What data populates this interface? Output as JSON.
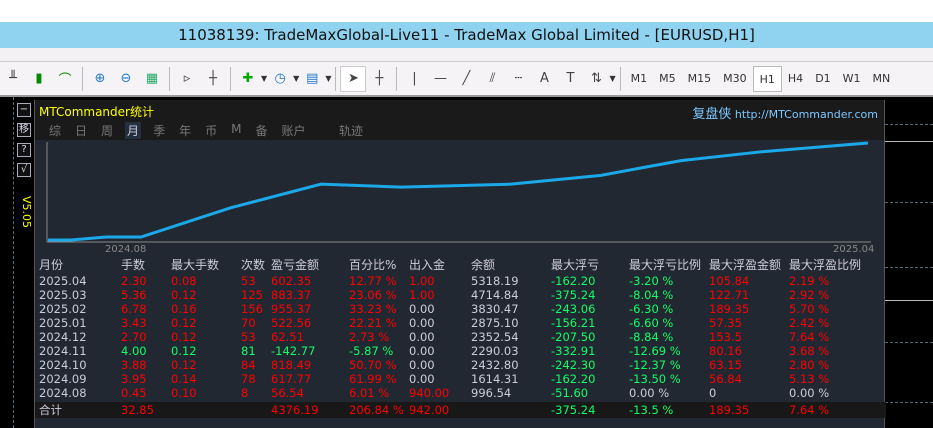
{
  "window": {
    "title": "11038139: TradeMaxGlobal-Live11 - TradeMax Global Limited - [EURUSD,H1]"
  },
  "toolbar": {
    "timeframes": [
      "M1",
      "M5",
      "M15",
      "M30",
      "H1",
      "H4",
      "D1",
      "W1",
      "MN"
    ],
    "active_timeframe": "H1"
  },
  "side": {
    "buttons": [
      "−",
      "移",
      "?",
      "√"
    ],
    "version": "V5.05"
  },
  "panel": {
    "title": "MTCommander统计",
    "brand": "复盘侠",
    "url": "http://MTCommander.com",
    "tabs": [
      "综",
      "日",
      "周",
      "月",
      "季",
      "年",
      "币",
      "M",
      "备",
      "账户"
    ],
    "active_tab": "月",
    "trail": "轨迹",
    "chart_start": "2024.08",
    "chart_end": "2025.04"
  },
  "chart_data": {
    "type": "line",
    "x_start": "2024.08",
    "x_end": "2025.04",
    "values": [
      0,
      0,
      1,
      1,
      11,
      19,
      18,
      19,
      22,
      27,
      30,
      33
    ]
  },
  "table": {
    "headers": [
      "月份",
      "手数",
      "最大手数",
      "次数",
      "盈亏金额",
      "百分比%",
      "出入金",
      "余额",
      "最大浮亏",
      "最大浮亏比例",
      "最大浮盈金额",
      "最大浮盈比例"
    ],
    "rows": [
      [
        "2025.04",
        "2.30",
        "0.08",
        "53",
        "602.35",
        "12.77 %",
        "1.00",
        "5318.19",
        "-162.20",
        "-3.20 %",
        "105.84",
        "2.19 %"
      ],
      [
        "2025.03",
        "5.36",
        "0.12",
        "125",
        "883.37",
        "23.06 %",
        "1.00",
        "4714.84",
        "-375.24",
        "-8.04 %",
        "122.71",
        "2.92 %"
      ],
      [
        "2025.02",
        "6.78",
        "0.16",
        "156",
        "955.37",
        "33.23 %",
        "0.00",
        "3830.47",
        "-243.06",
        "-6.30 %",
        "189.35",
        "5.70 %"
      ],
      [
        "2025.01",
        "3.43",
        "0.12",
        "70",
        "522.56",
        "22.21 %",
        "0.00",
        "2875.10",
        "-156.21",
        "-6.60 %",
        "57.35",
        "2.42 %"
      ],
      [
        "2024.12",
        "2.70",
        "0.12",
        "53",
        "62.51",
        "2.73 %",
        "0.00",
        "2352.54",
        "-207.50",
        "-8.84 %",
        "153.5",
        "7.64 %"
      ],
      [
        "2024.11",
        "4.00",
        "0.12",
        "81",
        "-142.77",
        "-5.87 %",
        "0.00",
        "2290.03",
        "-332.91",
        "-12.69 %",
        "80.16",
        "3.68 %"
      ],
      [
        "2024.10",
        "3.88",
        "0.12",
        "84",
        "818.49",
        "50.70 %",
        "0.00",
        "2432.80",
        "-242.30",
        "-12.37 %",
        "63.15",
        "2.80 %"
      ],
      [
        "2024.09",
        "3.95",
        "0.14",
        "78",
        "617.77",
        "61.99 %",
        "0.00",
        "1614.31",
        "-162.20",
        "-13.50 %",
        "56.84",
        "5.13 %"
      ],
      [
        "2024.08",
        "0.45",
        "0.10",
        "8",
        "56.54",
        "6.01 %",
        "940.00",
        "996.54",
        "-51.60",
        "0.00 %",
        "0",
        "0.00 %"
      ]
    ],
    "total": [
      "合计",
      "32.85",
      "",
      "",
      "4376.19",
      "206.84 %",
      "942.00",
      "",
      "-375.24",
      "-13.5 %",
      "189.35",
      "7.64 %"
    ]
  },
  "colors": {
    "profit": "#ff0000",
    "loss": "#11ff66",
    "neutral": "#ccccdd",
    "curve": "#1aa8e8"
  }
}
